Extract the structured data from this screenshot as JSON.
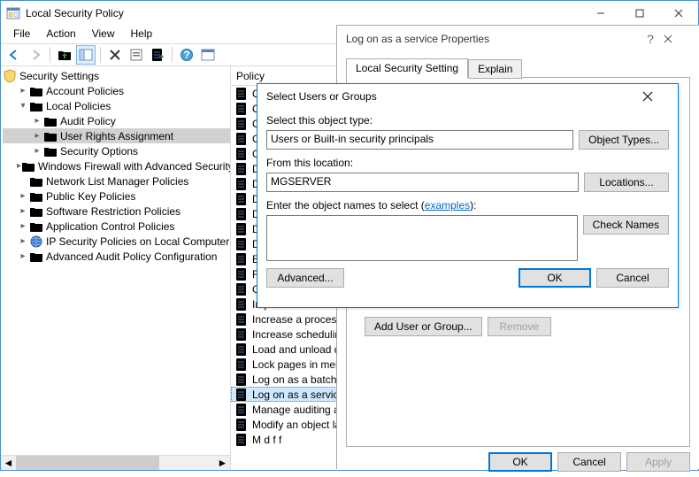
{
  "app": {
    "title": "Local Security Policy",
    "menus": [
      "File",
      "Action",
      "View",
      "Help"
    ]
  },
  "tree": {
    "root": "Security Settings",
    "items": [
      {
        "indent": 1,
        "twisty": ">",
        "label": "Account Policies"
      },
      {
        "indent": 1,
        "twisty": "v",
        "label": "Local Policies"
      },
      {
        "indent": 2,
        "twisty": ">",
        "label": "Audit Policy"
      },
      {
        "indent": 2,
        "twisty": ">",
        "label": "User Rights Assignment",
        "selected": true
      },
      {
        "indent": 2,
        "twisty": ">",
        "label": "Security Options"
      },
      {
        "indent": 1,
        "twisty": ">",
        "label": "Windows Firewall with Advanced Security"
      },
      {
        "indent": 1,
        "twisty": "",
        "label": "Network List Manager Policies"
      },
      {
        "indent": 1,
        "twisty": ">",
        "label": "Public Key Policies"
      },
      {
        "indent": 1,
        "twisty": ">",
        "label": "Software Restriction Policies"
      },
      {
        "indent": 1,
        "twisty": ">",
        "label": "Application Control Policies"
      },
      {
        "indent": 1,
        "twisty": ">",
        "label": "IP Security Policies on Local Computer",
        "icon": "ip"
      },
      {
        "indent": 1,
        "twisty": ">",
        "label": "Advanced Audit Policy Configuration"
      }
    ]
  },
  "list": {
    "header": "Policy",
    "items": [
      "Create a pagefile",
      "Create a token object",
      "Create global objects",
      "Create permanent shared objects",
      "Create symbolic links",
      "Debug programs",
      "Deny access to this computer from the network",
      "Deny log on as a batch job",
      "Deny log on as a service",
      "Deny log on locally",
      "Deny log on through Remote Desktop Services",
      "Enable computer and user accounts to be trusted for delegation",
      "Force shutdown from a remote system",
      "Generate security audits",
      "Impersonate a client after authentication",
      "Increase a process working set",
      "Increase scheduling priority",
      "Load and unload device drivers",
      "Lock pages in memory",
      "Log on as a batch job",
      "Log on as a service",
      "Manage auditing and security log",
      "Modify an object label",
      "Modify firmware environment values"
    ],
    "truncated": [
      "Crea",
      "Crea",
      "Crea",
      "Crea",
      "Crea",
      "Deb",
      "Deny",
      "Deny",
      "Deny",
      "Deny",
      "Deny",
      "Enab",
      "Forc",
      "Gen",
      "Impersonate a client",
      "Increase a process w",
      "Increase scheduling",
      "Load and unload dev",
      "Lock pages in memo",
      "Log on as a batch jo",
      "Log on as a service",
      "Manage auditing an",
      "Modify an object lab",
      "M   d f    f"
    ],
    "selected_index": 20
  },
  "props_dialog": {
    "title": "Log on as a service Properties",
    "tabs": [
      "Local Security Setting",
      "Explain"
    ],
    "add_btn": "Add User or Group...",
    "remove_btn": "Remove",
    "ok": "OK",
    "cancel": "Cancel",
    "apply": "Apply"
  },
  "select_dialog": {
    "title": "Select Users or Groups",
    "object_type_label": "Select this object type:",
    "object_type_value": "Users or Built-in security principals",
    "object_types_btn": "Object Types...",
    "location_label": "From this location:",
    "location_value": "MGSERVER",
    "locations_btn": "Locations...",
    "names_label_a": "Enter the object names to select (",
    "names_label_link": "examples",
    "names_label_b": "):",
    "check_names_btn": "Check Names",
    "advanced_btn": "Advanced...",
    "ok": "OK",
    "cancel": "Cancel"
  }
}
